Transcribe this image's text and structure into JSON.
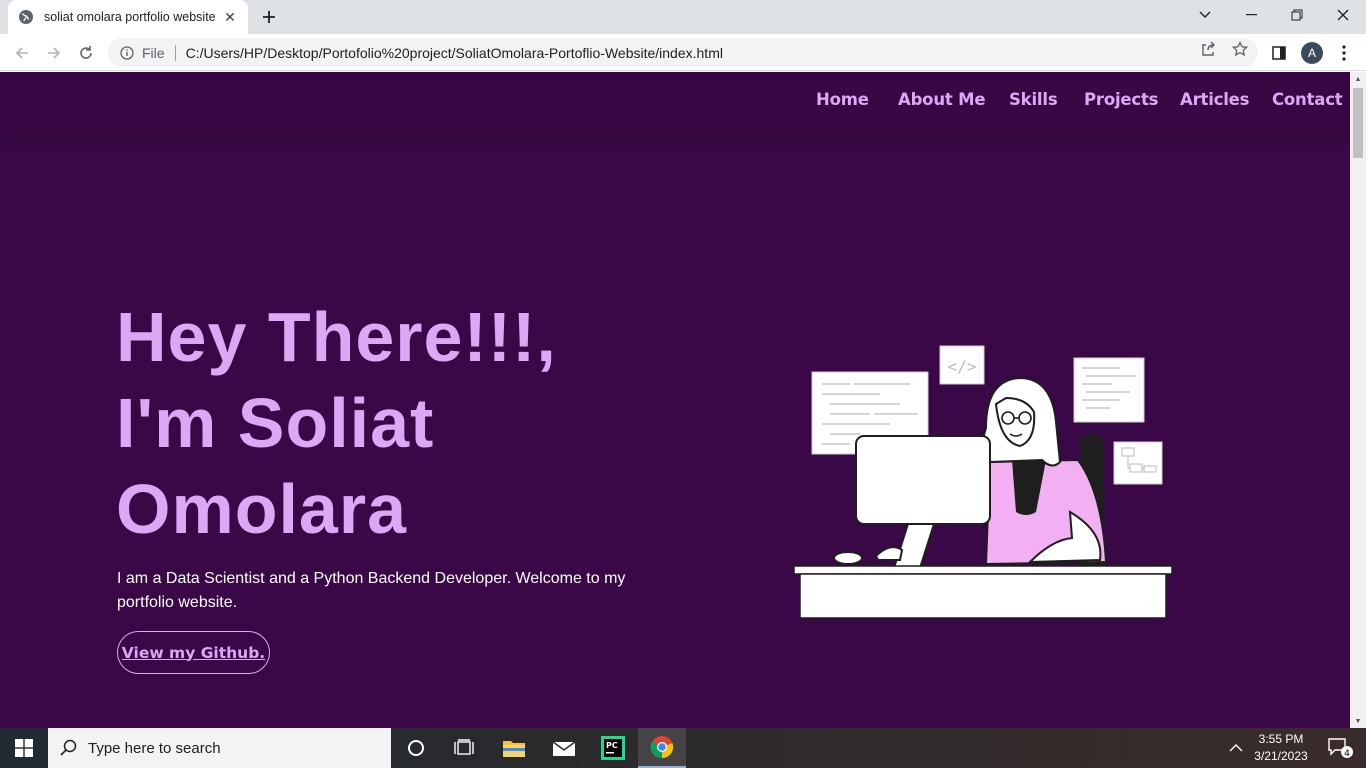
{
  "browser": {
    "tab_title": "soliat omolara portfolio website",
    "url_scheme": "File",
    "url": "C:/Users/HP/Desktop/Portofolio%20project/SoliatOmolara-Portoflio-Website/index.html",
    "profile_initial": "A"
  },
  "nav": {
    "items": [
      "Home",
      "About Me",
      "Skills",
      "Projects",
      "Articles",
      "Contact"
    ]
  },
  "hero": {
    "line1": "Hey There!!!,",
    "line2": "I'm Soliat",
    "line3": "Omolara",
    "description": "I am a Data Scientist and a Python Backend Developer. Welcome to my portfolio website.",
    "button_label": "View my Github."
  },
  "taskbar": {
    "search_placeholder": "Type here to search",
    "time": "3:55 PM",
    "date": "3/21/2023",
    "notification_count": "4"
  },
  "colors": {
    "page_bg": "#3a0846",
    "accent": "#dba8f4"
  }
}
